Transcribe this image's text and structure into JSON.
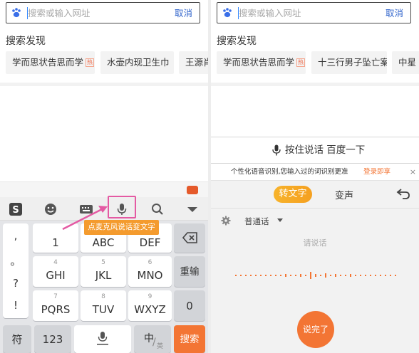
{
  "left": {
    "search": {
      "placeholder": "搜索或输入网址",
      "cancel": "取消"
    },
    "discover_title": "搜索发现",
    "chips": [
      {
        "text": "学而思状告思而学",
        "hot": "热"
      },
      {
        "text": "水壶内现卫生巾",
        "hot": ""
      },
      {
        "text": "王源肖战",
        "hot": ""
      }
    ],
    "toolbar": {
      "icons": [
        "sogou-logo-icon",
        "emoji-icon",
        "keyboard-icon",
        "microphone-icon",
        "search-icon",
        "collapse-icon"
      ]
    },
    "tooltip": "点麦克风说话变文字",
    "keyboard": {
      "punct": [
        ",",
        "。",
        "?",
        "!"
      ],
      "rows": [
        [
          {
            "sub": "",
            "main": "1"
          },
          {
            "sub": "2",
            "main": "ABC"
          },
          {
            "sub": "3",
            "main": "DEF"
          }
        ],
        [
          {
            "sub": "4",
            "main": "GHI"
          },
          {
            "sub": "5",
            "main": "JKL"
          },
          {
            "sub": "6",
            "main": "MNO"
          }
        ],
        [
          {
            "sub": "7",
            "main": "PQRS"
          },
          {
            "sub": "8",
            "main": "TUV"
          },
          {
            "sub": "9",
            "main": "WXYZ"
          }
        ]
      ],
      "retype": "重输",
      "zero": "0",
      "symbol": "符",
      "num": "123",
      "lang_zh": "中",
      "lang_en": "英",
      "search": "搜索"
    }
  },
  "right": {
    "search": {
      "placeholder": "搜索或输入网址",
      "cancel": "取消"
    },
    "discover_title": "搜索发现",
    "chips": [
      {
        "text": "学而思状告思而学",
        "hot": "热"
      },
      {
        "text": "十三行男子坠亡案",
        "hot": ""
      },
      {
        "text": "中星",
        "hot": ""
      }
    ],
    "voice_button": "按住说话 百度一下",
    "notice": {
      "text": "个性化语音识别,您输入过的词识别更准",
      "link": "登录即享",
      "close": "×"
    },
    "tabs": {
      "active": "转文字",
      "other": "变声"
    },
    "language": "普通话",
    "hint": "请说话",
    "done": "说完了"
  },
  "colors": {
    "accent": "#f37534",
    "link": "#3366cc",
    "highlight": "#e45aa3",
    "tooltip": "#f49b2e"
  }
}
